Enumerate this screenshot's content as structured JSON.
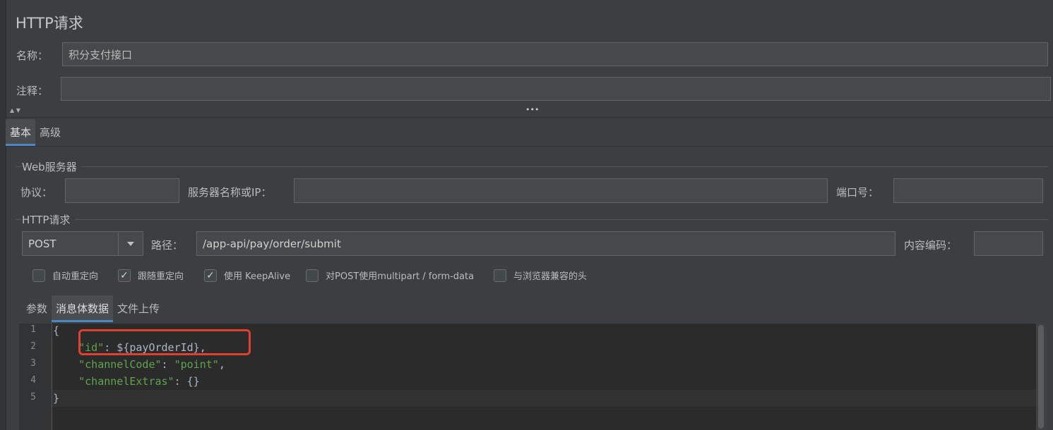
{
  "title": "HTTP请求",
  "name": {
    "label": "名称：",
    "value": "积分支付接口"
  },
  "comment": {
    "label": "注释：",
    "value": ""
  },
  "splitter": {
    "arrows": "▲ ▼",
    "grip": "•••"
  },
  "tabs": {
    "basic": "基本",
    "advanced": "高级"
  },
  "web_server": {
    "title": "Web服务器",
    "protocol_label": "协议：",
    "protocol_value": "",
    "server_label": "服务器名称或IP：",
    "server_value": "",
    "port_label": "端口号：",
    "port_value": ""
  },
  "http_request": {
    "title": "HTTP请求",
    "method": "POST",
    "path_label": "路径：",
    "path": "/app-api/pay/order/submit",
    "encoding_label": "内容编码：",
    "encoding_value": ""
  },
  "checkboxes": [
    {
      "label": "自动重定向",
      "checked": false,
      "mark": ""
    },
    {
      "label": "跟随重定向",
      "checked": true,
      "mark": "✓"
    },
    {
      "label": "使用 KeepAlive",
      "checked": true,
      "mark": "✓"
    },
    {
      "label": "对POST使用multipart / form-data",
      "checked": false,
      "mark": ""
    },
    {
      "label": "与浏览器兼容的头",
      "checked": false,
      "mark": ""
    }
  ],
  "body_tabs": {
    "params": "参数",
    "body_data": "消息体数据",
    "files": "文件上传"
  },
  "code": {
    "line_numbers": [
      "1",
      "2",
      "3",
      "4",
      "5"
    ],
    "l1": "{",
    "l2_key": "\"id\"",
    "l2_rest": ": ${payOrderId},",
    "l3_key": "\"channelCode\"",
    "l3_sep": ": ",
    "l3_val": "\"point\"",
    "l3_end": ",",
    "l4_key": "\"channelExtras\"",
    "l4_rest": ": {}",
    "l5": "}"
  },
  "colors": {
    "highlight": "#e0402f",
    "accent": "#4a88c7",
    "json_string": "#5fa34d"
  }
}
